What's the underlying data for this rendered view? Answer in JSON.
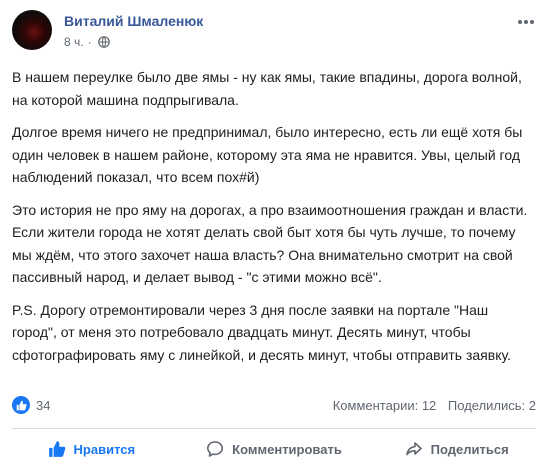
{
  "post": {
    "author": "Виталий Шмаленюк",
    "time": "8 ч.",
    "separator": "·",
    "paragraphs": [
      "В нашем переулке было две ямы - ну как ямы, такие впадины, дорога волной, на которой машина подпрыгивала.",
      "Долгое время ничего не предпринимал, было интересно, есть ли ещё хотя бы один человек в нашем районе, которому эта яма не нравится. Увы, целый год наблюдений показал, что всем пох#й)",
      "Это история не про яму на дорогах, а про взаимоотношения граждан и власти. Если жители города не хотят делать свой быт хотя бы чуть лучше, то почему мы ждём, что этого захочет наша власть? Она внимательно смотрит на свой пассивный народ, и делает вывод - \"с этими можно всё\".",
      "P.S. Дорогу отремонтировали через 3 дня после заявки на портале \"Наш город\", от меня это потребовало двадцать минут. Десять минут, чтобы сфотографировать яму с линейкой, и десять минут, чтобы отправить заявку."
    ]
  },
  "reactions": {
    "count": "34",
    "comments": "Комментарии: 12",
    "shares": "Поделились: 2"
  },
  "actions": {
    "like": "Нравится",
    "comment": "Комментировать",
    "share": "Поделиться"
  },
  "colors": {
    "author": "#385898",
    "accent": "#1877f2",
    "muted": "#606770"
  },
  "icons": {
    "privacy": "globe-icon",
    "menu": "more-options-icon",
    "reaction": "like-reaction-icon",
    "like": "thumbs-up-icon",
    "comment": "comment-icon",
    "share": "share-icon"
  }
}
